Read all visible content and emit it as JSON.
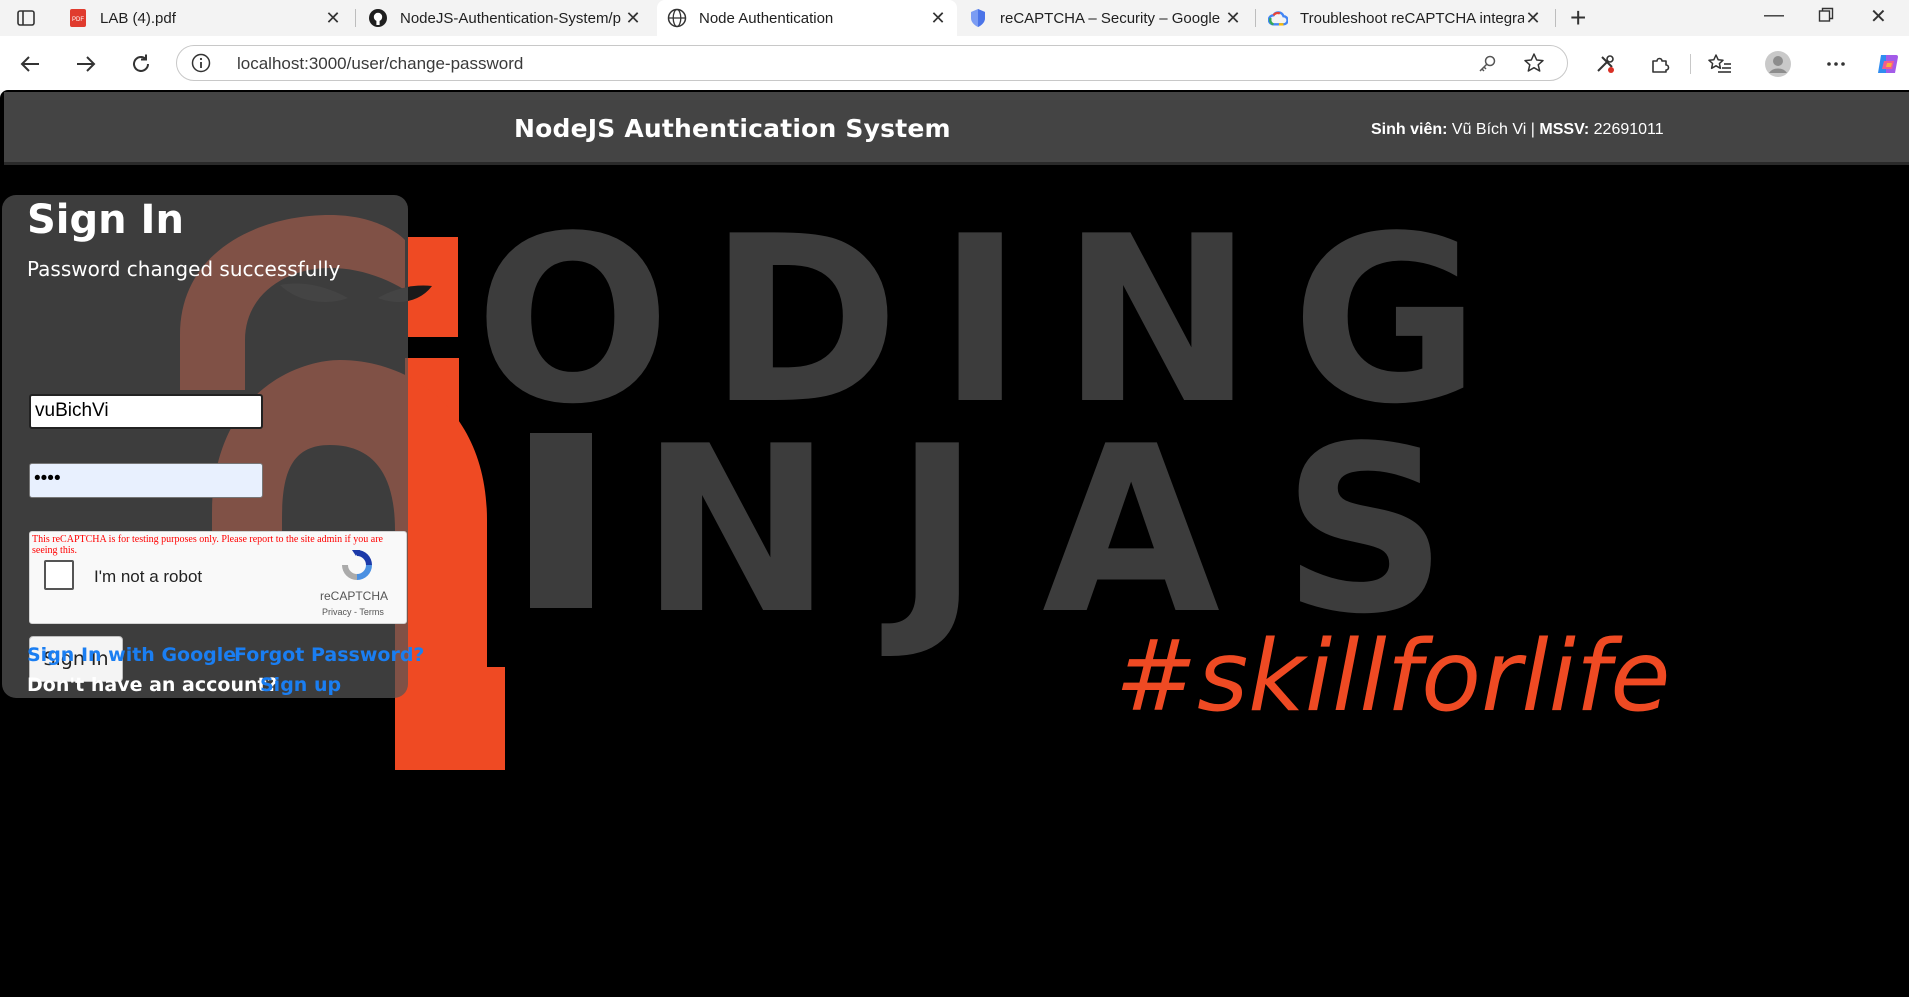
{
  "browser": {
    "tabs": [
      {
        "title": "LAB (4).pdf",
        "icon": "pdf-icon"
      },
      {
        "title": "NodeJS-Authentication-System/p",
        "icon": "github-icon"
      },
      {
        "title": "Node Authentication",
        "icon": "globe-icon"
      },
      {
        "title": "reCAPTCHA – Security – Google C",
        "icon": "shield-icon"
      },
      {
        "title": "Troubleshoot reCAPTCHA integrat",
        "icon": "google-cloud-icon"
      }
    ],
    "url": "localhost:3000/user/change-password"
  },
  "header": {
    "title": "NodeJS Authentication System",
    "student_label": "Sinh viên:",
    "student_name": "Vũ Bích Vi",
    "separator": "|",
    "id_label": "MSSV:",
    "id_value": "22691011"
  },
  "signin": {
    "heading": "Sign In",
    "message": "Password changed successfully",
    "username_value": "vuBichVi",
    "password_mask": "••••",
    "recaptcha": {
      "warning": "This reCAPTCHA is for testing purposes only. Please report to the site admin if you are seeing this.",
      "checkbox_label": "I'm not a robot",
      "brand": "reCAPTCHA",
      "privacy": "Privacy",
      "dash": " - ",
      "terms": "Terms"
    },
    "submit_label": "Sign In",
    "google_link": "Sign In with Google",
    "forgot_link": "Forgot Password?",
    "no_account_text": "Don't have an account?",
    "signup_link": "Sign up"
  },
  "background_art": {
    "line1": "ODING",
    "line2": "NJAS",
    "tagline": "#skillforlife",
    "accent_color": "#ef4a23",
    "letter_color": "#3c3c3c"
  }
}
